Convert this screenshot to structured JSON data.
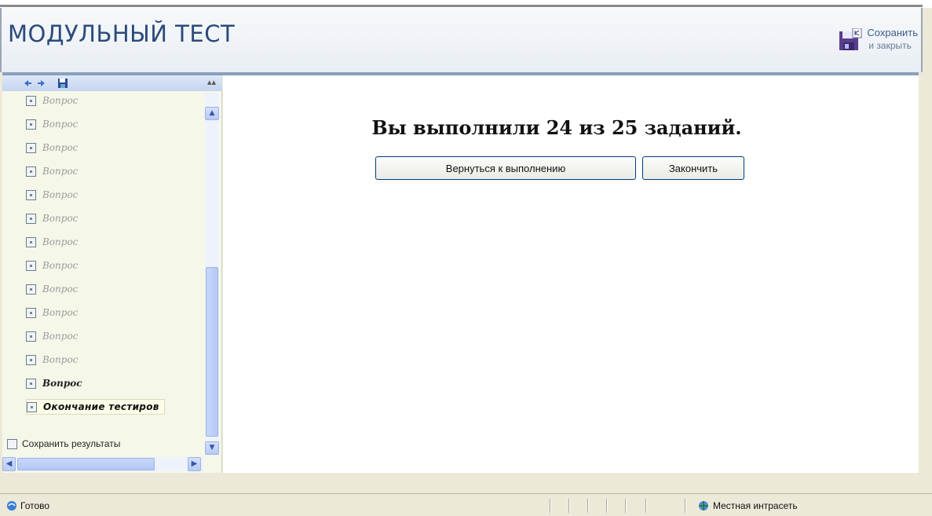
{
  "header": {
    "title": "МОДУЛЬНЫЙ ТЕСТ",
    "save_close_line1": "Сохранить",
    "save_close_line2": "и закрыть"
  },
  "sidebar": {
    "items": [
      {
        "label": "Вопрос"
      },
      {
        "label": "Вопрос"
      },
      {
        "label": "Вопрос"
      },
      {
        "label": "Вопрос"
      },
      {
        "label": "Вопрос"
      },
      {
        "label": "Вопрос"
      },
      {
        "label": "Вопрос"
      },
      {
        "label": "Вопрос"
      },
      {
        "label": "Вопрос"
      },
      {
        "label": "Вопрос"
      },
      {
        "label": "Вопрос"
      },
      {
        "label": "Вопрос"
      },
      {
        "label": "Вопрос"
      },
      {
        "label": "Окончание тестиров"
      }
    ],
    "save_results": "Сохранить результаты"
  },
  "main": {
    "result_message": "Вы выполнили 24 из 25 заданий.",
    "return_button": "Вернуться к выполнению",
    "finish_button": "Закончить"
  },
  "status": {
    "left_text": "Готово",
    "zone_text": "Местная интрасеть"
  },
  "colors": {
    "title": "#2b4a7a",
    "toolbar": "#c4d5ef",
    "sidebar_bg": "#f5f8e9"
  }
}
